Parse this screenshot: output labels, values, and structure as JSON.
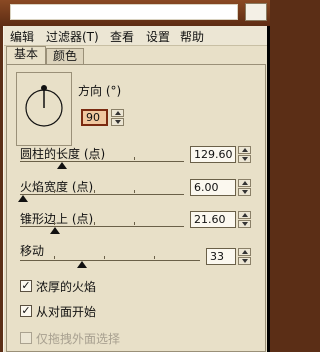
{
  "menu": [
    "编辑",
    "过滤器(T)",
    "查看",
    "设置",
    "帮助"
  ],
  "tabs": [
    "基本",
    "颜色"
  ],
  "direction": {
    "label": "方向 (°)",
    "value": "90"
  },
  "params": [
    {
      "label": "圆柱的长度 (点)",
      "value": "129.60"
    },
    {
      "label": "火焰宽度 (点)",
      "value": "6.00"
    },
    {
      "label": "锥形边上 (点)",
      "value": "21.60"
    },
    {
      "label": "移动",
      "value": "33"
    }
  ],
  "options": [
    {
      "label": "浓厚的火焰",
      "checked": true,
      "enabled": true
    },
    {
      "label": "从对面开始",
      "checked": true,
      "enabled": true
    },
    {
      "label": "仅拖拽外面选择",
      "checked": false,
      "enabled": false
    }
  ]
}
